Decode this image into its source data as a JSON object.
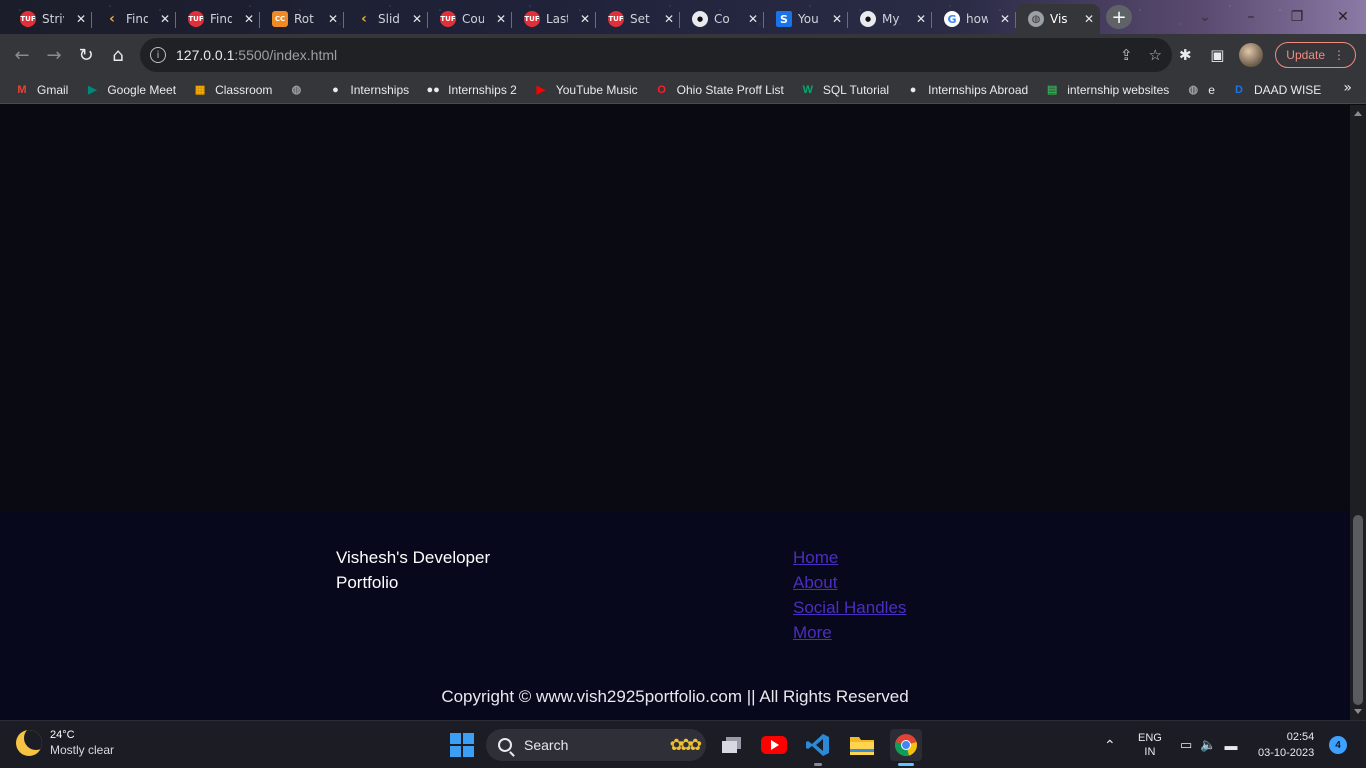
{
  "browser": {
    "tabs": [
      {
        "title": "Striver",
        "icon": "tuf-icon"
      },
      {
        "title": "Find",
        "icon": "slide-icon"
      },
      {
        "title": "Find",
        "icon": "tuf-icon"
      },
      {
        "title": "Rot",
        "icon": "cc-icon"
      },
      {
        "title": "Slid",
        "icon": "slide-icon"
      },
      {
        "title": "Cou",
        "icon": "tuf-icon"
      },
      {
        "title": "Last",
        "icon": "tuf-icon"
      },
      {
        "title": "Set",
        "icon": "tuf-icon"
      },
      {
        "title": "Co",
        "icon": "github-icon"
      },
      {
        "title": "You",
        "icon": "s-icon"
      },
      {
        "title": "My",
        "icon": "github-icon"
      },
      {
        "title": "how",
        "icon": "google-icon"
      },
      {
        "title": "Vis",
        "icon": "globe-icon",
        "active": true
      }
    ],
    "url_host": "127.0.0.1",
    "url_rest": ":5500/index.html",
    "update_label": "Update",
    "bookmarks": [
      {
        "label": "Gmail",
        "icon": "gmail-icon",
        "color": "#ea4335"
      },
      {
        "label": "Google Meet",
        "icon": "meet-icon",
        "color": "#00897b"
      },
      {
        "label": "Classroom",
        "icon": "classroom-icon",
        "color": "#f9ab00"
      },
      {
        "label": "",
        "icon": "globe-icon",
        "color": "#9aa0a6"
      },
      {
        "label": "Internships",
        "icon": "github-icon",
        "color": "#e8eaed"
      },
      {
        "label": "Internships 2",
        "icon": "medium-icon",
        "color": "#e8eaed"
      },
      {
        "label": "YouTube Music",
        "icon": "youtube-music-icon",
        "color": "#ff0000"
      },
      {
        "label": "Ohio State Proff List",
        "icon": "opera-icon",
        "color": "#ff1b2d"
      },
      {
        "label": "SQL Tutorial",
        "icon": "w3schools-icon",
        "color": "#04aa6d"
      },
      {
        "label": "Internships Abroad",
        "icon": "github-icon",
        "color": "#e8eaed"
      },
      {
        "label": "internship websites",
        "icon": "sheets-icon",
        "color": "#34a853"
      },
      {
        "label": "e",
        "icon": "globe-icon",
        "color": "#9aa0a6"
      },
      {
        "label": "DAAD WISE",
        "icon": "d-icon",
        "color": "#1a73e8"
      }
    ],
    "bookmarks_more": "»"
  },
  "page": {
    "brand": "Vishesh's Developer Portfolio",
    "links": [
      "Home",
      "About",
      "Social Handles",
      "More"
    ],
    "copyright": "Copyright © www.vish2925portfolio.com || All Rights Reserved",
    "link_color": "#4a2ec0"
  },
  "taskbar": {
    "weather_temp": "24°C",
    "weather_desc": "Mostly clear",
    "search_placeholder": "Search",
    "lang_1": "ENG",
    "lang_2": "IN",
    "time": "02:54",
    "date": "03-10-2023",
    "notifications": "4"
  }
}
